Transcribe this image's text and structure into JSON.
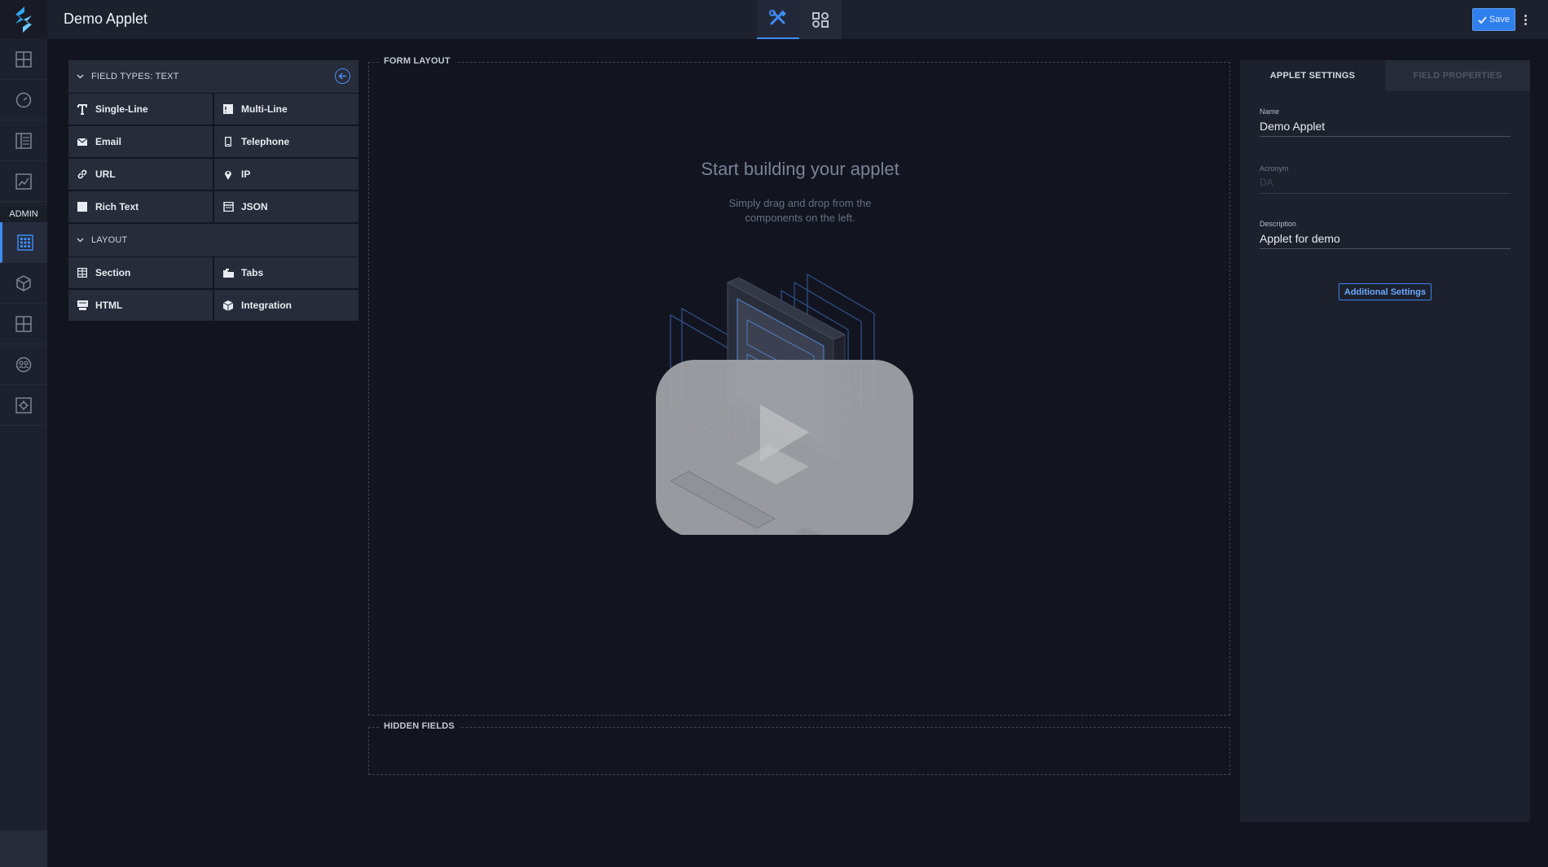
{
  "app": {
    "title": "Demo Applet",
    "save_label": "Save"
  },
  "mode_tabs": [
    {
      "name": "designer",
      "icon": "tools-icon",
      "active": true
    },
    {
      "name": "workflow",
      "icon": "workflow-icon",
      "active": false
    }
  ],
  "left_nav": {
    "admin_label": "ADMIN",
    "items": [
      {
        "icon": "dashboard-icon"
      },
      {
        "icon": "gauge-icon"
      },
      {
        "icon": "records-icon"
      },
      {
        "icon": "reports-icon"
      },
      {
        "icon": "applets-icon",
        "active": true
      },
      {
        "icon": "cube-icon"
      },
      {
        "icon": "workspaces-icon"
      },
      {
        "icon": "users-icon"
      },
      {
        "icon": "settings-icon"
      }
    ]
  },
  "palette": {
    "text_section": "FIELD TYPES: TEXT",
    "text_fields": [
      {
        "label": "Single-Line",
        "icon": "text-t-icon"
      },
      {
        "label": "Multi-Line",
        "icon": "multiline-icon"
      },
      {
        "label": "Email",
        "icon": "envelope-icon"
      },
      {
        "label": "Telephone",
        "icon": "phone-icon"
      },
      {
        "label": "URL",
        "icon": "link-icon"
      },
      {
        "label": "IP",
        "icon": "map-pin-icon"
      },
      {
        "label": "Rich Text",
        "icon": "rich-text-icon"
      },
      {
        "label": "JSON",
        "icon": "json-icon"
      }
    ],
    "layout_section": "LAYOUT",
    "layout_fields": [
      {
        "label": "Section",
        "icon": "section-grid-icon"
      },
      {
        "label": "Tabs",
        "icon": "tabs-icon"
      },
      {
        "label": "HTML",
        "icon": "html-icon"
      },
      {
        "label": "Integration",
        "icon": "integration-cube-icon"
      }
    ]
  },
  "form_layout": {
    "legend": "FORM LAYOUT",
    "empty_title": "Start building your applet",
    "empty_sub_line1": "Simply drag and drop from the",
    "empty_sub_line2": "components on the left."
  },
  "hidden_fields": {
    "legend": "HIDDEN FIELDS"
  },
  "settings": {
    "tabs": [
      "APPLET SETTINGS",
      "FIELD PROPERTIES"
    ],
    "name_label": "Name",
    "name_value": "Demo Applet",
    "acronym_label": "Acronym",
    "acronym_placeholder": "DA",
    "description_label": "Description",
    "description_value": "Applet for demo",
    "additional_settings_label": "Additional Settings"
  },
  "colors": {
    "accent": "#3d8cf6",
    "background": "#121520",
    "panel": "#1d212d",
    "tile": "#272c3a"
  }
}
